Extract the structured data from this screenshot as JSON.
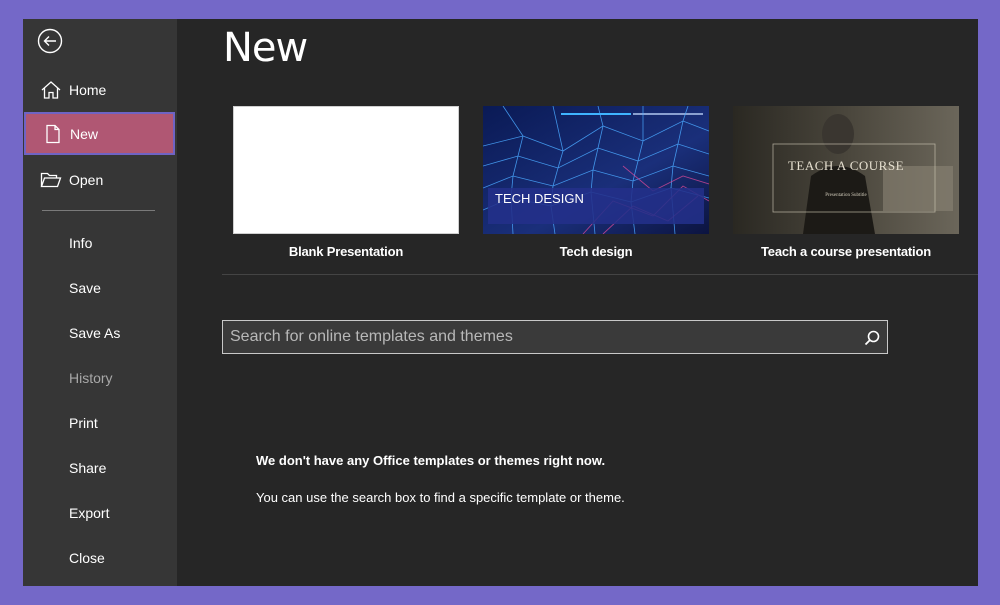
{
  "backstage": {
    "title": "New",
    "nav": {
      "home": "Home",
      "new": "New",
      "open": "Open",
      "info": "Info",
      "save": "Save",
      "save_as": "Save As",
      "history": "History",
      "print": "Print",
      "share": "Share",
      "export": "Export",
      "close": "Close"
    },
    "templates": [
      {
        "name": "Blank Presentation"
      },
      {
        "name": "Tech design",
        "thumb_text": "TECH DESIGN"
      },
      {
        "name": "Teach a course presentation",
        "thumb_text": "TEACH A COURSE",
        "thumb_subtext": "Presentation Subtitle"
      }
    ],
    "search": {
      "placeholder": "Search for online templates and themes"
    },
    "message": {
      "headline": "We don't have any Office templates or themes right now.",
      "detail": "You can use the search box to find a specific template or theme."
    }
  },
  "colors": {
    "frame": "#7468c8",
    "background": "#262626",
    "sidebar": "#363636",
    "active_item": "#b05773",
    "active_border": "#6f63c4"
  },
  "icons": [
    "back-arrow-icon",
    "home-icon",
    "new-document-icon",
    "open-folder-icon",
    "search-icon"
  ]
}
